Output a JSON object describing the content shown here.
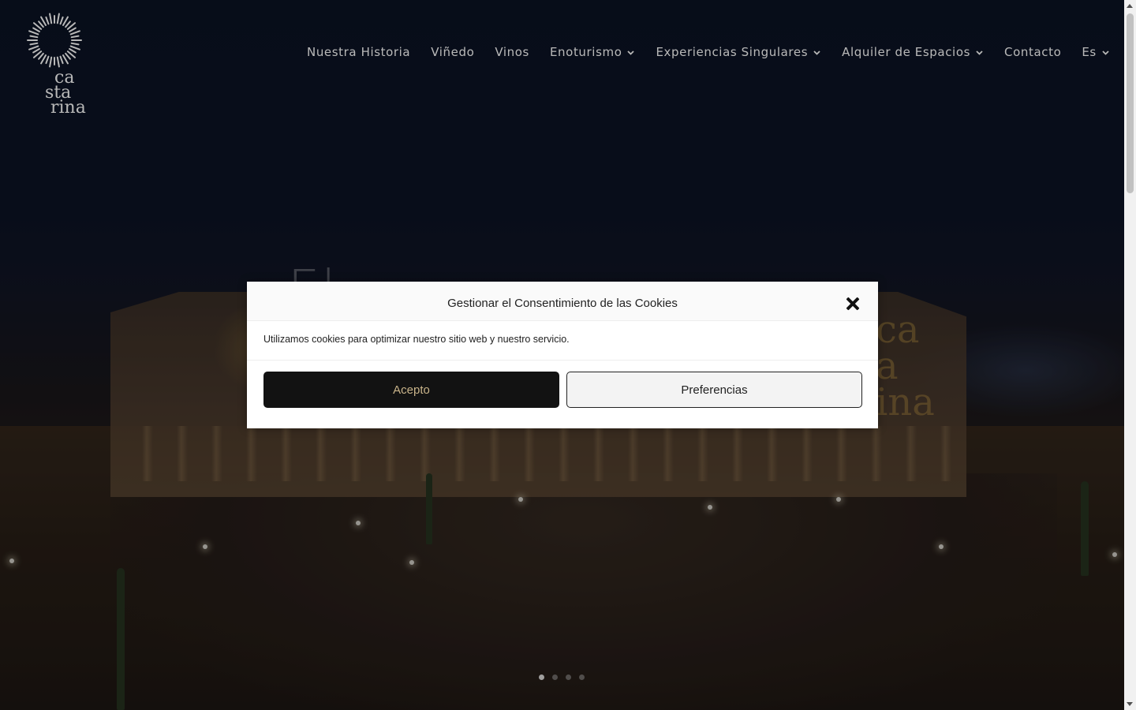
{
  "brand": {
    "logo_lines": [
      "ca",
      "sta",
      "rina"
    ]
  },
  "nav": {
    "items": [
      {
        "label": "Nuestra Historia",
        "dropdown": false
      },
      {
        "label": "Viñedo",
        "dropdown": false
      },
      {
        "label": "Vinos",
        "dropdown": false
      },
      {
        "label": "Enoturismo",
        "dropdown": true
      },
      {
        "label": "Experiencias Singulares",
        "dropdown": true
      },
      {
        "label": "Alquiler de Espacios",
        "dropdown": true
      },
      {
        "label": "Contacto",
        "dropdown": false
      },
      {
        "label": "Es",
        "dropdown": true
      }
    ]
  },
  "hero": {
    "heading": "El",
    "slides_total": 4,
    "active_slide": 1
  },
  "cookie_modal": {
    "title": "Gestionar el Consentimiento de las Cookies",
    "message": "Utilizamos cookies para optimizar nuestro sitio web y nuestro servicio.",
    "accept_label": "Acepto",
    "preferences_label": "Preferencias",
    "close_icon": "close-icon"
  },
  "colors": {
    "accept_button_bg": "#121212",
    "accept_button_text": "#c9b48a",
    "nav_text": "#ffffff"
  }
}
